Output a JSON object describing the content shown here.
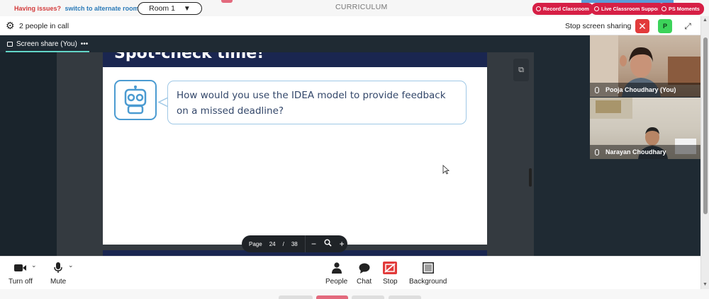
{
  "topbar": {
    "issues_text": "Having issues?",
    "alt_link": "switch to alternate room",
    "room_label": "Room 1",
    "room_caret": "▼",
    "page_title": "CURRICULUM",
    "pills": [
      {
        "label": "Record Classroom"
      },
      {
        "label": "Live Classroom Support"
      },
      {
        "label": "PS Moments"
      }
    ]
  },
  "callbar": {
    "people_count": "2 people in call",
    "stop_share": "Stop screen sharing",
    "close_glyph": "✕",
    "presenter_initial": "P",
    "expand_glyph": "⤢"
  },
  "stage": {
    "share_label": "Screen share (You)",
    "share_more": "•••",
    "slide_title": "Spot-check time!",
    "slide_question": "How would you use the IDEA model to provide feedback on a missed deadline?",
    "external_icon": "⧉",
    "pager": {
      "label": "Page",
      "current": "24",
      "separator": "/",
      "total": "38",
      "zoom_out": "−",
      "zoom_in": "+"
    }
  },
  "participants": [
    {
      "name": "Pooja Choudhary (You)"
    },
    {
      "name": "Narayan Choudhary"
    }
  ],
  "controls": {
    "camera": "Turn off",
    "mute": "Mute",
    "people": "People",
    "chat": "Chat",
    "stop": "Stop",
    "background": "Background"
  },
  "colors": {
    "accent_red": "#d61f45",
    "stage_bg": "#1f2a33",
    "slide_navy": "#1a2650",
    "share_underline": "#63d6c8",
    "robot_blue": "#4b9bd1"
  }
}
